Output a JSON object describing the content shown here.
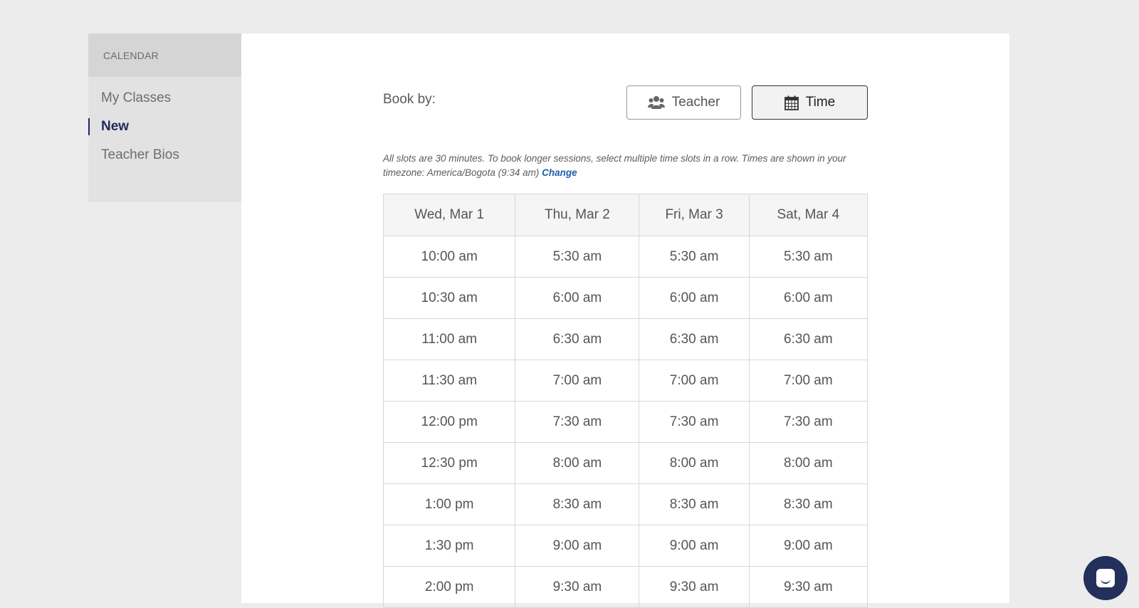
{
  "sidebar": {
    "header": "CALENDAR",
    "items": [
      {
        "label": "My Classes"
      },
      {
        "label": "New"
      },
      {
        "label": "Teacher Bios"
      }
    ]
  },
  "booking": {
    "book_by_label": "Book by:",
    "toggle": {
      "teacher_label": "Teacher",
      "time_label": "Time",
      "selected": "Time"
    },
    "note": "All slots are 30 minutes. To book longer sessions, select multiple time slots in a row. Times are shown in your timezone: America/Bogota (9:34 am)",
    "change_link": "Change"
  },
  "table": {
    "columns": [
      "Wed, Mar 1",
      "Thu, Mar 2",
      "Fri, Mar 3",
      "Sat, Mar 4"
    ],
    "rows": [
      [
        "10:00 am",
        "5:30 am",
        "5:30 am",
        "5:30 am"
      ],
      [
        "10:30 am",
        "6:00 am",
        "6:00 am",
        "6:00 am"
      ],
      [
        "11:00 am",
        "6:30 am",
        "6:30 am",
        "6:30 am"
      ],
      [
        "11:30 am",
        "7:00 am",
        "7:00 am",
        "7:00 am"
      ],
      [
        "12:00 pm",
        "7:30 am",
        "7:30 am",
        "7:30 am"
      ],
      [
        "12:30 pm",
        "8:00 am",
        "8:00 am",
        "8:00 am"
      ],
      [
        "1:00 pm",
        "8:30 am",
        "8:30 am",
        "8:30 am"
      ],
      [
        "1:30 pm",
        "9:00 am",
        "9:00 am",
        "9:00 am"
      ],
      [
        "2:00 pm",
        "9:30 am",
        "9:30 am",
        "9:30 am"
      ]
    ]
  },
  "colors": {
    "accent": "#1f2a5e",
    "link": "#1d5fa8",
    "chat": "#23305c"
  },
  "icons": {
    "teacher": "users-icon",
    "time": "calendar-icon",
    "chat": "chat-icon"
  }
}
